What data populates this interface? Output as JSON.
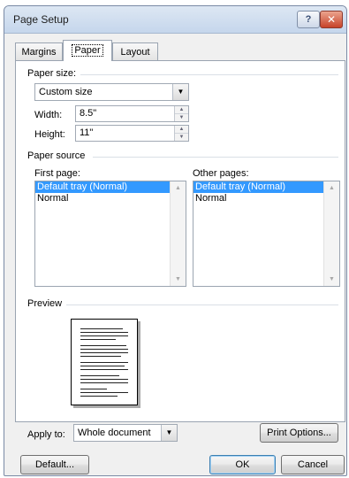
{
  "window": {
    "title": "Page Setup",
    "help_label": "?",
    "close_label": "✕"
  },
  "tabs": [
    {
      "label": "Margins"
    },
    {
      "label": "Paper"
    },
    {
      "label": "Layout"
    }
  ],
  "paper_size": {
    "group_label": "Paper size:",
    "selected": "Custom size",
    "width_label": "Width:",
    "width_value": "8.5\"",
    "height_label": "Height:",
    "height_value": "11\""
  },
  "paper_source": {
    "group_label": "Paper source",
    "first_page_label": "First page:",
    "other_pages_label": "Other pages:",
    "first_page_items": [
      "Default tray (Normal)",
      "Normal"
    ],
    "other_pages_items": [
      "Default tray (Normal)",
      "Normal"
    ]
  },
  "preview": {
    "group_label": "Preview"
  },
  "apply_to": {
    "label": "Apply to:",
    "selected": "Whole document"
  },
  "buttons": {
    "print_options": "Print Options...",
    "default": "Default...",
    "ok": "OK",
    "cancel": "Cancel"
  },
  "icons": {
    "dropdown": "▼",
    "spin_up": "▲",
    "spin_down": "▼",
    "scroll_up": "▲",
    "scroll_down": "▼"
  },
  "colors": {
    "selection": "#3399ff",
    "titlebar": "#c5d6ec",
    "close": "#c7432a"
  }
}
